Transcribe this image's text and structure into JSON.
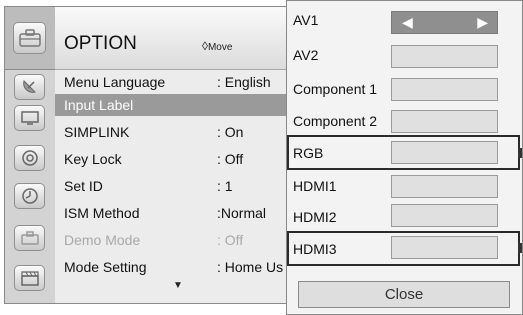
{
  "menu": {
    "title": "OPTION",
    "move_hint": "Move",
    "move_hint_icon": "dpad-icon",
    "more_indicator_icon": "down-triangle-icon",
    "items": [
      {
        "label": "Menu Language",
        "value": ": English",
        "state": "normal"
      },
      {
        "label": "Input Label",
        "value": "",
        "state": "selected"
      },
      {
        "label": "SIMPLINK",
        "value": ": On",
        "state": "normal"
      },
      {
        "label": "Key Lock",
        "value": ": Off",
        "state": "normal"
      },
      {
        "label": "Set ID",
        "value": ": 1",
        "state": "normal"
      },
      {
        "label": "ISM Method",
        "value": ":Normal",
        "state": "normal"
      },
      {
        "label": "Demo Mode",
        "value": ": Off",
        "state": "disabled"
      },
      {
        "label": "Mode Setting",
        "value": ": Home Us",
        "state": "normal"
      }
    ]
  },
  "sidebar": {
    "icons": [
      "option-toolbox-icon",
      "satellite-dish-icon",
      "monitor-icon",
      "speaker-icon",
      "clock-icon",
      "toolbox-icon",
      "film-clapper-icon"
    ]
  },
  "input_label": {
    "inputs": [
      {
        "name": "AV1",
        "selector": "active",
        "left_arrow": "◀",
        "right_arrow": "▶"
      },
      {
        "name": "AV2",
        "selector": "empty"
      },
      {
        "name": "Component 1",
        "selector": "empty"
      },
      {
        "name": "Component 2",
        "selector": "empty"
      },
      {
        "name": "RGB",
        "selector": "empty",
        "outlined": true
      },
      {
        "name": "HDMI1",
        "selector": "empty"
      },
      {
        "name": "HDMI2",
        "selector": "empty"
      },
      {
        "name": "HDMI3",
        "selector": "empty",
        "outlined": true
      }
    ],
    "close_label": "Close"
  },
  "colors": {
    "selected_row_bg": "#9a9a9a",
    "disabled_text": "#a9a9a9",
    "active_field_bg": "#8f8f8f"
  }
}
